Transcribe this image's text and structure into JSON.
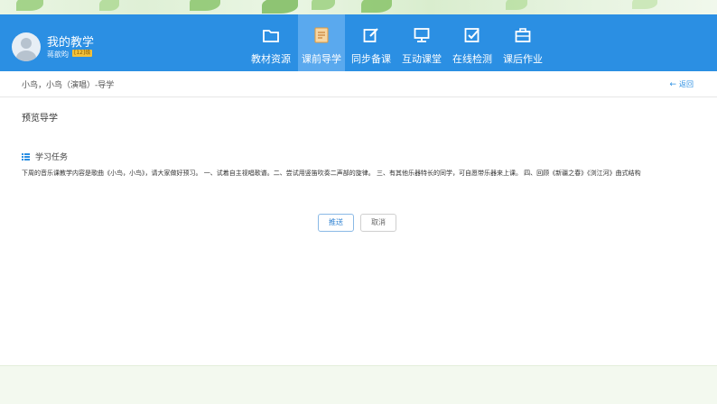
{
  "header": {
    "app_title": "我的教学",
    "user_name": "蒋歆昀",
    "user_badge": "[12]级",
    "nav": [
      {
        "label": "教材资源",
        "icon": "folder-icon",
        "active": false
      },
      {
        "label": "课前导学",
        "icon": "notebook-icon",
        "active": true
      },
      {
        "label": "同步备课",
        "icon": "edit-icon",
        "active": false
      },
      {
        "label": "互动课堂",
        "icon": "monitor-icon",
        "active": false
      },
      {
        "label": "在线检测",
        "icon": "checkbox-icon",
        "active": false
      },
      {
        "label": "课后作业",
        "icon": "briefcase-icon",
        "active": false
      }
    ]
  },
  "breadcrumb": {
    "text": "小鸟，小鸟（演唱）-导学",
    "back_label": "返回"
  },
  "main": {
    "section_title": "预览导学",
    "task_heading": "学习任务",
    "task_text": "下周的音乐课教学内容是歌曲《小鸟，小鸟》，请大家做好预习。 一、试着自主视唱歌谱。二、尝试用竖笛吹奏二声部的旋律。 三、有其他乐器特长的同学，可自愿带乐器来上课。 四、回顾《新疆之春》《浏江河》曲式结构"
  },
  "actions": {
    "push_label": "推送",
    "cancel_label": "取消"
  },
  "colors": {
    "header_bg": "#2b8fe3",
    "active_nav_bg": "#5aa9ee",
    "accent": "#2b8fe3"
  }
}
